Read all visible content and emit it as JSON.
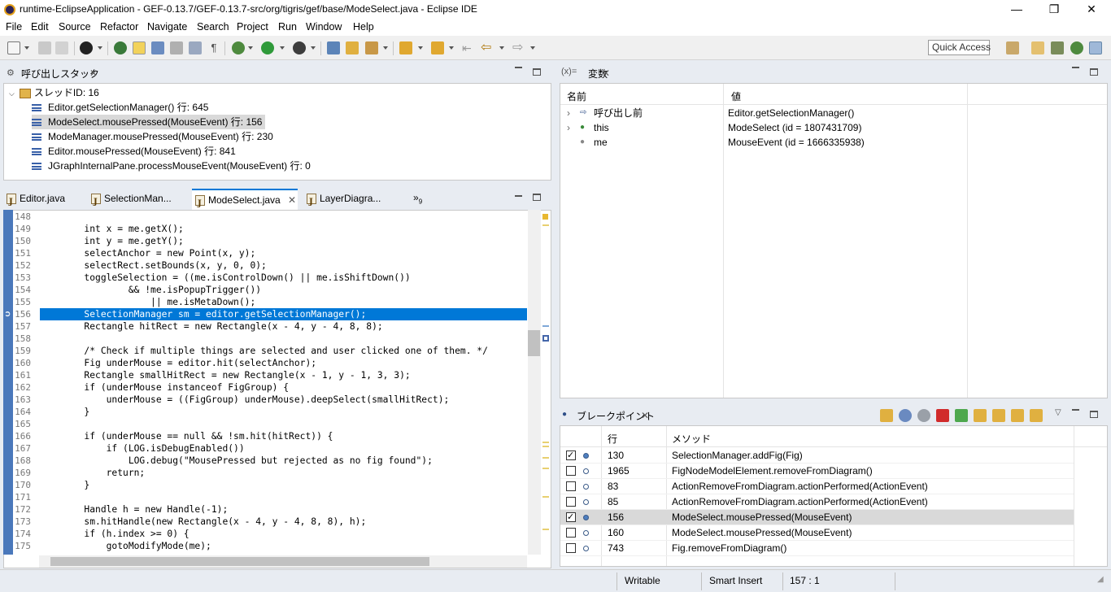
{
  "window": {
    "title": "runtime-EclipseApplication - GEF-0.13.7/GEF-0.13.7-src/org/tigris/gef/base/ModeSelect.java - Eclipse IDE",
    "minimize": "—",
    "restore": "❐",
    "close": "✕"
  },
  "menu": [
    "File",
    "Edit",
    "Source",
    "Refactor",
    "Navigate",
    "Search",
    "Project",
    "Run",
    "Window",
    "Help"
  ],
  "toolbar": {
    "quick_access": "Quick Access"
  },
  "call_stack": {
    "title": "呼び出しスタック",
    "thread": "スレッドID: 16",
    "frames": [
      "Editor.getSelectionManager() 行: 645",
      "ModeSelect.mousePressed(MouseEvent) 行: 156",
      "ModeManager.mousePressed(MouseEvent) 行: 230",
      "Editor.mousePressed(MouseEvent) 行: 841",
      "JGraphInternalPane.processMouseEvent(MouseEvent) 行: 0"
    ],
    "selected_index": 1
  },
  "editor": {
    "tabs": [
      "Editor.java",
      "SelectionMan...",
      "ModeSelect.java",
      "LayerDiagra..."
    ],
    "active_tab": 2,
    "overflow": "»",
    "overflow_count": "9",
    "current_line": "156",
    "lines": [
      {
        "n": "148",
        "t": ""
      },
      {
        "n": "149",
        "t": "        int x = me.getX();"
      },
      {
        "n": "150",
        "t": "        int y = me.getY();"
      },
      {
        "n": "151",
        "t": "        selectAnchor = new Point(x, y);"
      },
      {
        "n": "152",
        "t": "        selectRect.setBounds(x, y, 0, 0);"
      },
      {
        "n": "153",
        "t": "        toggleSelection = ((me.isControlDown() || me.isShiftDown())"
      },
      {
        "n": "154",
        "t": "                && !me.isPopupTrigger())"
      },
      {
        "n": "155",
        "t": "                    || me.isMetaDown();"
      },
      {
        "n": "156",
        "t": "        SelectionManager sm = editor.getSelectionManager();"
      },
      {
        "n": "157",
        "t": "        Rectangle hitRect = new Rectangle(x - 4, y - 4, 8, 8);"
      },
      {
        "n": "158",
        "t": ""
      },
      {
        "n": "159",
        "t": "        /* Check if multiple things are selected and user clicked one of them. */"
      },
      {
        "n": "160",
        "t": "        Fig underMouse = editor.hit(selectAnchor);"
      },
      {
        "n": "161",
        "t": "        Rectangle smallHitRect = new Rectangle(x - 1, y - 1, 3, 3);"
      },
      {
        "n": "162",
        "t": "        if (underMouse instanceof FigGroup) {"
      },
      {
        "n": "163",
        "t": "            underMouse = ((FigGroup) underMouse).deepSelect(smallHitRect);"
      },
      {
        "n": "164",
        "t": "        }"
      },
      {
        "n": "165",
        "t": ""
      },
      {
        "n": "166",
        "t": "        if (underMouse == null && !sm.hit(hitRect)) {"
      },
      {
        "n": "167",
        "t": "            if (LOG.isDebugEnabled())"
      },
      {
        "n": "168",
        "t": "                LOG.debug(\"MousePressed but rejected as no fig found\");"
      },
      {
        "n": "169",
        "t": "            return;"
      },
      {
        "n": "170",
        "t": "        }"
      },
      {
        "n": "171",
        "t": ""
      },
      {
        "n": "172",
        "t": "        Handle h = new Handle(-1);"
      },
      {
        "n": "173",
        "t": "        sm.hitHandle(new Rectangle(x - 4, y - 4, 8, 8), h);"
      },
      {
        "n": "174",
        "t": "        if (h.index >= 0) {"
      },
      {
        "n": "175",
        "t": "            gotoModifyMode(me);"
      }
    ]
  },
  "variables": {
    "title": "変数",
    "icon_label": "(x)=",
    "col_name": "名前",
    "col_value": "値",
    "rows": [
      {
        "name": "呼び出し前",
        "value": "Editor.getSelectionManager()"
      },
      {
        "name": "this",
        "value": "ModeSelect  (id = 1807431709)"
      },
      {
        "name": "me",
        "value": "MouseEvent  (id = 1666335938)"
      }
    ]
  },
  "breakpoints": {
    "title": "ブレークポイント",
    "col_line": "行",
    "col_method": "メソッド",
    "rows": [
      {
        "line": "130",
        "method": "SelectionManager.addFig(Fig)",
        "checked": true
      },
      {
        "line": "1965",
        "method": "FigNodeModelElement.removeFromDiagram()",
        "checked": false
      },
      {
        "line": "83",
        "method": "ActionRemoveFromDiagram.actionPerformed(ActionEvent)",
        "checked": false
      },
      {
        "line": "85",
        "method": "ActionRemoveFromDiagram.actionPerformed(ActionEvent)",
        "checked": false
      },
      {
        "line": "156",
        "method": "ModeSelect.mousePressed(MouseEvent)",
        "checked": true
      },
      {
        "line": "160",
        "method": "ModeSelect.mousePressed(MouseEvent)",
        "checked": false
      },
      {
        "line": "743",
        "method": "Fig.removeFromDiagram()",
        "checked": false
      }
    ],
    "selected_index": 4
  },
  "status": {
    "writable": "Writable",
    "insert_mode": "Smart Insert",
    "position": "157 : 1"
  },
  "colors": {
    "accent": "#0078d7",
    "gutter": "#4a78bb",
    "selection": "#d9d9d9"
  }
}
